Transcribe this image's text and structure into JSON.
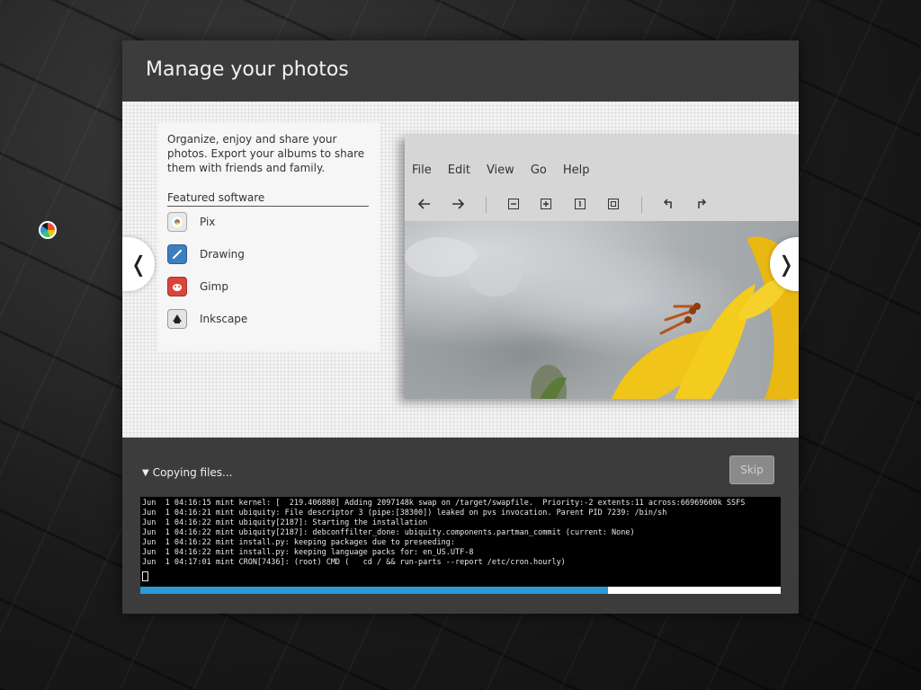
{
  "window": {
    "title": "Manage your photos"
  },
  "slide": {
    "description": "Organize, enjoy and share your photos. Export your albums to share them with friends and family.",
    "featured_heading": "Featured software",
    "software": [
      {
        "label": "Pix",
        "icon": "pix-icon"
      },
      {
        "label": "Drawing",
        "icon": "drawing-icon"
      },
      {
        "label": "Gimp",
        "icon": "gimp-icon"
      },
      {
        "label": "Inkscape",
        "icon": "inkscape-icon"
      }
    ],
    "screenshot": {
      "menu": [
        "File",
        "Edit",
        "View",
        "Go",
        "Help"
      ],
      "toolbar": [
        "back-arrow-icon",
        "forward-arrow-icon",
        "zoom-out-icon",
        "zoom-in-icon",
        "zoom-normal-icon",
        "zoom-fit-icon",
        "rotate-left-icon",
        "rotate-right-icon"
      ]
    },
    "prev_glyph": "❬",
    "next_glyph": "❭"
  },
  "install": {
    "status": "Copying files...",
    "skip_label": "Skip",
    "progress_fraction": 0.73,
    "log": [
      "Jun  1 04:16:15 mint kernel: [  219.406880] Adding 2097148k swap on /target/swapfile.  Priority:-2 extents:11 across:66969600k SSFS",
      "Jun  1 04:16:21 mint ubiquity: File descriptor 3 (pipe:[38300]) leaked on pvs invocation. Parent PID 7239: /bin/sh",
      "Jun  1 04:16:22 mint ubiquity[2187]: Starting the installation",
      "Jun  1 04:16:22 mint ubiquity[2187]: debconffilter_done: ubiquity.components.partman_commit (current: None)",
      "Jun  1 04:16:22 mint install.py: keeping packages due to preseeding:",
      "Jun  1 04:16:22 mint install.py: keeping language packs for: en_US.UTF-8",
      "Jun  1 04:17:01 mint CRON[7436]: (root) CMD (   cd / && run-parts --report /etc/cron.hourly)"
    ]
  },
  "colors": {
    "accent": "#2b9ad6",
    "window_bg": "#3c3c3c"
  }
}
